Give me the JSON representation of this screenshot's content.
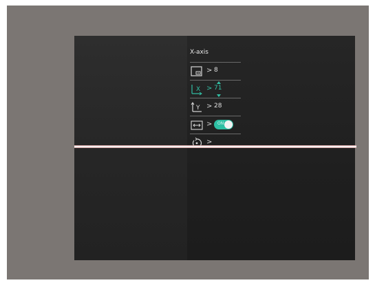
{
  "menu": {
    "title": "X-axis",
    "rows": [
      {
        "icon": "zoom-window-icon",
        "value": "8",
        "selected": false
      },
      {
        "icon": "x-axis-icon",
        "label": "X",
        "value": "71",
        "selected": true
      },
      {
        "icon": "y-axis-icon",
        "label": "Y",
        "value": "28",
        "selected": false
      },
      {
        "icon": "horizontal-expand-icon",
        "toggle_label": "ON",
        "toggle_on": true,
        "selected": false
      },
      {
        "icon": "reset-icon",
        "selected": false
      }
    ],
    "chevron": ">"
  },
  "colors": {
    "accent": "#33c1a6",
    "frame": "#7b7673",
    "screen": "#262626",
    "line": "#f6f0f0"
  }
}
